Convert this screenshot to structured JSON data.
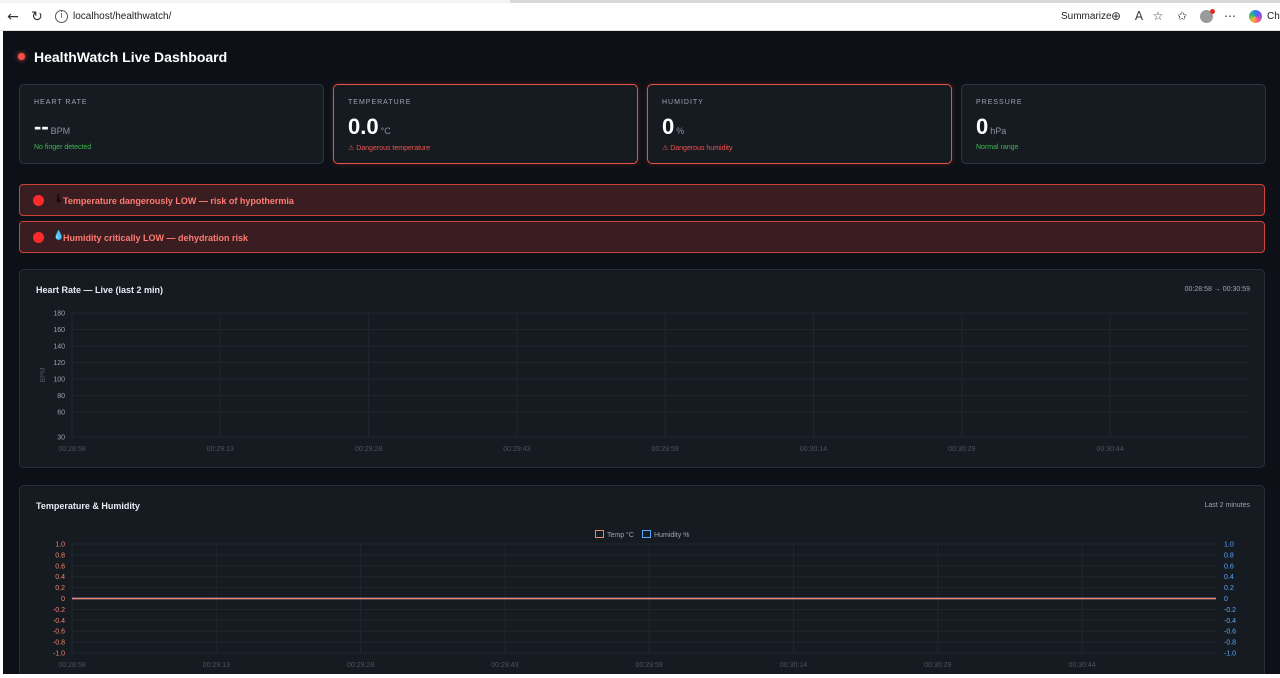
{
  "browser": {
    "url": "localhost/healthwatch/",
    "summarize_label": "Summarize",
    "copilot_label": "Cha"
  },
  "dashboard": {
    "title": "HealthWatch Live Dashboard",
    "cards": [
      {
        "label": "HEART RATE",
        "value": "--",
        "unit": "BPM",
        "status": "No finger detected",
        "state": "ok"
      },
      {
        "label": "TEMPERATURE",
        "value": "0.0",
        "unit": "°C",
        "status": "⚠ Dangerous temperature",
        "state": "danger"
      },
      {
        "label": "HUMIDITY",
        "value": "0",
        "unit": "%",
        "status": "⚠ Dangerous humidity",
        "state": "danger"
      },
      {
        "label": "PRESSURE",
        "value": "0",
        "unit": "hPa",
        "status": "Normal range",
        "state": "ok"
      }
    ],
    "alerts": [
      {
        "icon": "🌡",
        "icon_name": "thermometer-icon",
        "text": "Temperature dangerously LOW — risk of hypothermia"
      },
      {
        "icon": "💧",
        "icon_name": "droplet-icon",
        "text": "Humidity critically LOW — dehydration risk"
      }
    ],
    "colors": {
      "danger": "#f85149",
      "ok": "#3fb950",
      "background": "#0d1117",
      "panel": "#161b22",
      "temp": "#f0836f",
      "humidity": "#58a6ff"
    }
  },
  "chart_data": [
    {
      "type": "line",
      "title": "Heart Rate — Live (last 2 min)",
      "subtitle": "00:28:58 → 00:30:59",
      "ylabel": "BPM",
      "yticks": [
        30,
        60,
        80,
        100,
        120,
        140,
        160,
        180
      ],
      "ylim": [
        30,
        180
      ],
      "x_tick_labels": [
        "00:28:58",
        "00:29:13",
        "00:29:28",
        "00:29:43",
        "00:29:59",
        "00:30:14",
        "00:30:29",
        "00:30:44"
      ],
      "series": [],
      "grid": true
    },
    {
      "type": "line",
      "title": "Temperature & Humidity",
      "subtitle": "Last 2 minutes",
      "yticks": [
        -1.0,
        -0.8,
        -0.6,
        -0.4,
        -0.2,
        0,
        0.2,
        0.4,
        0.6,
        0.8,
        1.0
      ],
      "ylim": [
        -1.0,
        1.0
      ],
      "x_tick_labels": [
        "00:28:58",
        "00:29:13",
        "00:29:28",
        "00:29:43",
        "00:29:59",
        "00:30:14",
        "00:30:29",
        "00:30:44"
      ],
      "series": [
        {
          "name": "Temp °C",
          "color": "#f0836f",
          "values": [
            0,
            0,
            0,
            0,
            0,
            0,
            0,
            0
          ]
        },
        {
          "name": "Humidity %",
          "color": "#58a6ff",
          "values": [
            0,
            0,
            0,
            0,
            0,
            0,
            0,
            0
          ]
        }
      ],
      "legend": "top-center",
      "grid": true
    }
  ]
}
